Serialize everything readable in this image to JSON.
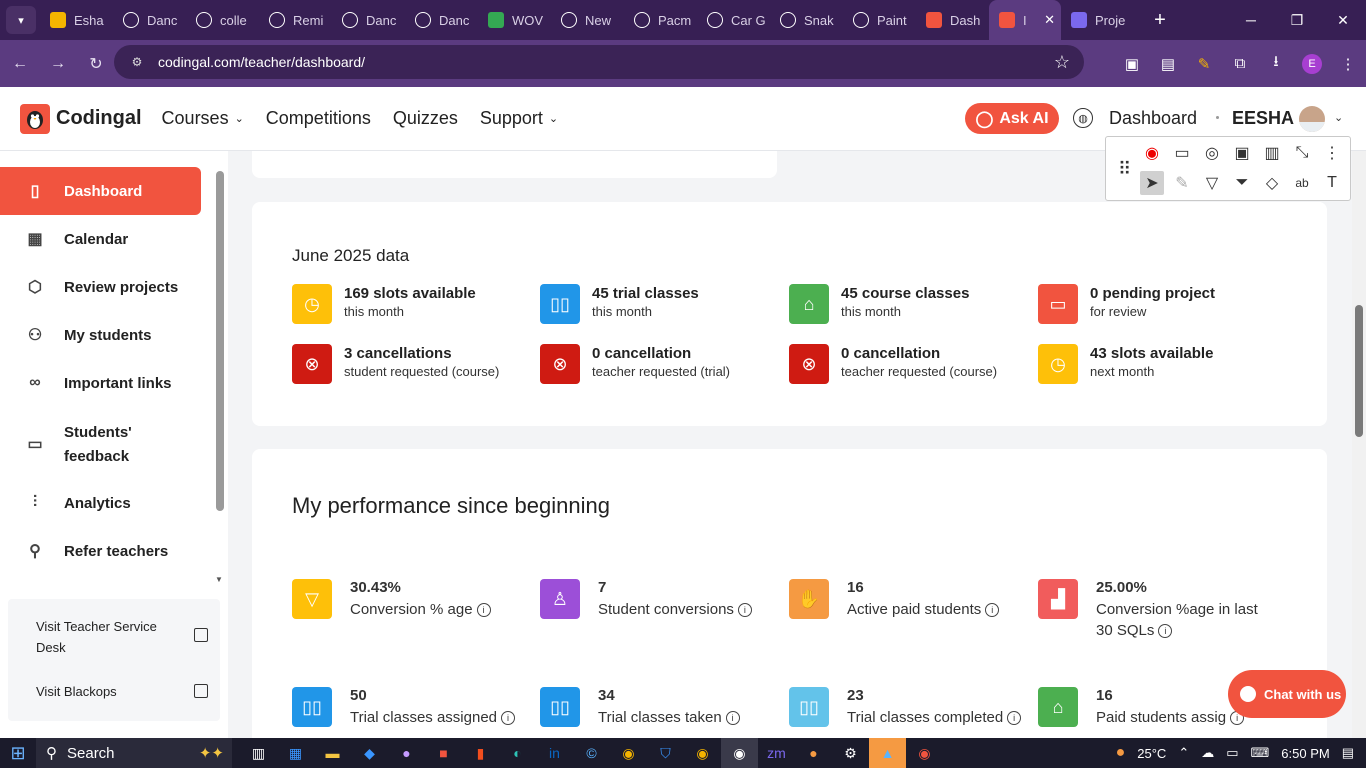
{
  "browser": {
    "tabs": [
      {
        "label": "Esha",
        "color": "#f4b400"
      },
      {
        "label": "Danc",
        "color": "#ffffff"
      },
      {
        "label": "colle",
        "color": "#ffffff"
      },
      {
        "label": "Remi",
        "color": "#ffffff"
      },
      {
        "label": "Danc",
        "color": "#ffffff"
      },
      {
        "label": "Danc",
        "color": "#ffffff"
      },
      {
        "label": "WOV",
        "color": "#34a853"
      },
      {
        "label": "New",
        "color": "#ffffff"
      },
      {
        "label": "Pacm",
        "color": "#ffffff"
      },
      {
        "label": "Car G",
        "color": "#ffffff"
      },
      {
        "label": "Snak",
        "color": "#ffffff"
      },
      {
        "label": "Paint",
        "color": "#ffffff"
      },
      {
        "label": "Dash",
        "color": "#f1543f"
      },
      {
        "label": "I",
        "color": "#f1543f"
      },
      {
        "label": "Proje",
        "color": "#7b68ee"
      }
    ],
    "url": "codingal.com/teacher/dashboard/",
    "profile_initial": "E"
  },
  "header": {
    "brand": "Codingal",
    "nav": [
      {
        "label": "Courses",
        "dropdown": true
      },
      {
        "label": "Competitions",
        "dropdown": false
      },
      {
        "label": "Quizzes",
        "dropdown": false
      },
      {
        "label": "Support",
        "dropdown": true
      }
    ],
    "ask_ai": "Ask AI",
    "dashboard": "Dashboard",
    "user": "EESHA"
  },
  "sidebar": {
    "items": [
      {
        "label": "Dashboard",
        "icon": "clipboard-icon",
        "active": true
      },
      {
        "label": "Calendar",
        "icon": "calendar-icon"
      },
      {
        "label": "Review projects",
        "icon": "cube-icon"
      },
      {
        "label": "My students",
        "icon": "users-icon"
      },
      {
        "label": "Important links",
        "icon": "link-icon"
      },
      {
        "label": "Students' feedback",
        "icon": "feedback-icon"
      },
      {
        "label": "Analytics",
        "icon": "analytics-icon"
      },
      {
        "label": "Refer teachers",
        "icon": "refer-icon"
      }
    ],
    "visit_links": [
      "Visit Teacher Service Desk",
      "Visit Blackops"
    ]
  },
  "monthly": {
    "title": "June 2025 data",
    "stats": [
      {
        "main": "169 slots available",
        "sub": "this month",
        "color": "#fec009",
        "icon": "clock-icon"
      },
      {
        "main": "45 trial classes",
        "sub": "this month",
        "color": "#2196e8",
        "icon": "book-icon"
      },
      {
        "main": "45 course classes",
        "sub": "this month",
        "color": "#4caf50",
        "icon": "graduation-cap-icon"
      },
      {
        "main": "0 pending project",
        "sub": "for review",
        "color": "#f1543f",
        "icon": "monitor-icon"
      },
      {
        "main": "3 cancellations",
        "sub": "student requested (course)",
        "color": "#cf1b12",
        "icon": "cancel-icon"
      },
      {
        "main": "0 cancellation",
        "sub": "teacher requested (trial)",
        "color": "#cf1b12",
        "icon": "cancel-icon"
      },
      {
        "main": "0 cancellation",
        "sub": "teacher requested (course)",
        "color": "#cf1b12",
        "icon": "cancel-icon"
      },
      {
        "main": "43 slots available",
        "sub": "next month",
        "color": "#fec009",
        "icon": "clock-icon"
      }
    ]
  },
  "performance": {
    "title": "My performance since beginning",
    "stats": [
      {
        "value": "30.43%",
        "label": "Conversion % age",
        "color": "#fec009",
        "icon": "funnel-icon"
      },
      {
        "value": "7",
        "label": "Student conversions",
        "color": "#9c4fd8",
        "icon": "user-icon"
      },
      {
        "value": "16",
        "label": "Active paid students",
        "color": "#f59a42",
        "icon": "hand-icon"
      },
      {
        "value": "25.00%",
        "label": "Conversion %age in last 30 SQLs",
        "color": "#f15c5c",
        "icon": "bar-chart-icon"
      },
      {
        "value": "50",
        "label": "Trial classes assigned",
        "color": "#2196e8",
        "icon": "book-icon"
      },
      {
        "value": "34",
        "label": "Trial classes taken",
        "color": "#2196e8",
        "icon": "book-icon"
      },
      {
        "value": "23",
        "label": "Trial classes completed",
        "color": "#63c3ea",
        "icon": "book-icon"
      },
      {
        "value": "16",
        "label": "Paid students assig",
        "color": "#4caf50",
        "icon": "graduation-cap-icon"
      }
    ]
  },
  "chat_widget": "Chat with us",
  "taskbar": {
    "search": "Search",
    "weather": "25°C",
    "time": "6:50 PM"
  }
}
